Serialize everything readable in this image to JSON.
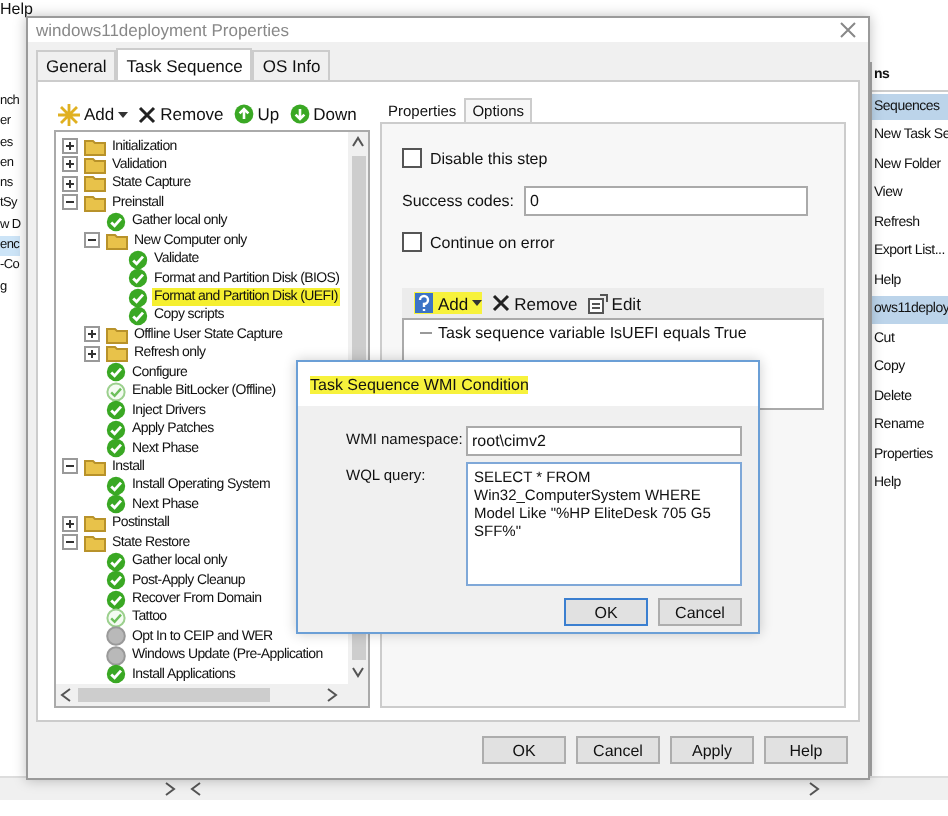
{
  "background_window": {
    "menu": "Help",
    "left_pane": [
      {
        "label": "nch",
        "selected": false
      },
      {
        "label": "er",
        "selected": false
      },
      {
        "label": "es",
        "selected": false
      },
      {
        "label": "en",
        "selected": false
      },
      {
        "label": "ns",
        "selected": false
      },
      {
        "label": "tSy",
        "selected": false
      },
      {
        "label": "w D",
        "selected": false
      },
      {
        "label": "enc",
        "selected": true
      },
      {
        "label": "-Co",
        "selected": false
      },
      {
        "label": "g",
        "selected": false
      }
    ],
    "actions": [
      {
        "kind": "header",
        "label": "ns"
      },
      {
        "kind": "section",
        "label": "Sequences"
      },
      {
        "kind": "action",
        "label": "New Task Se"
      },
      {
        "kind": "action",
        "label": "New Folder"
      },
      {
        "kind": "action",
        "label": "View"
      },
      {
        "kind": "action",
        "label": "Refresh"
      },
      {
        "kind": "action",
        "label": "Export List..."
      },
      {
        "kind": "action",
        "label": "Help"
      },
      {
        "kind": "section",
        "label": "ows11deploy"
      },
      {
        "kind": "action",
        "label": "Cut"
      },
      {
        "kind": "action",
        "label": "Copy"
      },
      {
        "kind": "action",
        "label": "Delete"
      },
      {
        "kind": "action",
        "label": "Rename"
      },
      {
        "kind": "action",
        "label": "Properties"
      },
      {
        "kind": "action",
        "label": "Help"
      }
    ]
  },
  "dialog": {
    "title": "windows11deployment Properties",
    "tabs": [
      {
        "label": "General",
        "selected": false
      },
      {
        "label": "Task Sequence",
        "selected": true
      },
      {
        "label": "OS Info",
        "selected": false
      }
    ],
    "toolbar": [
      {
        "kind": "add",
        "label": "Add"
      },
      {
        "kind": "remove",
        "label": "Remove"
      },
      {
        "kind": "up",
        "label": "Up"
      },
      {
        "kind": "down",
        "label": "Down"
      }
    ],
    "tree": [
      {
        "label": "Initialization",
        "kind": "group",
        "expanded": false,
        "selected": false
      },
      {
        "label": "Validation",
        "kind": "group",
        "expanded": false,
        "selected": false
      },
      {
        "label": "State Capture",
        "kind": "group",
        "expanded": false,
        "selected": false
      },
      {
        "label": "Preinstall",
        "kind": "group",
        "expanded": true,
        "selected": false,
        "children": [
          {
            "label": "Gather local only",
            "kind": "step",
            "selected": false
          },
          {
            "label": "New Computer only",
            "kind": "group",
            "expanded": true,
            "selected": false,
            "children": [
              {
                "label": "Validate",
                "kind": "step",
                "selected": false
              },
              {
                "label": "Format and Partition Disk (BIOS)",
                "kind": "step",
                "selected": false
              },
              {
                "label": "Format and Partition Disk (UEFI)",
                "kind": "step",
                "selected": true
              },
              {
                "label": "Copy scripts",
                "kind": "step",
                "selected": false
              }
            ]
          },
          {
            "label": "Offline User State Capture",
            "kind": "group",
            "expanded": false,
            "selected": false
          },
          {
            "label": "Refresh only",
            "kind": "group",
            "expanded": false,
            "selected": false
          },
          {
            "label": "Configure",
            "kind": "step",
            "selected": false
          },
          {
            "label": "Enable BitLocker (Offline)",
            "kind": "step-faint",
            "selected": false
          },
          {
            "label": "Inject Drivers",
            "kind": "step",
            "selected": false
          },
          {
            "label": "Apply Patches",
            "kind": "step",
            "selected": false
          },
          {
            "label": "Next Phase",
            "kind": "step",
            "selected": false
          }
        ]
      },
      {
        "label": "Install",
        "kind": "group",
        "expanded": true,
        "selected": false,
        "children": [
          {
            "label": "Install Operating System",
            "kind": "step",
            "selected": false
          },
          {
            "label": "Next Phase",
            "kind": "step",
            "selected": false
          }
        ]
      },
      {
        "label": "Postinstall",
        "kind": "group",
        "expanded": false,
        "selected": false
      },
      {
        "label": "State Restore",
        "kind": "group",
        "expanded": true,
        "selected": false,
        "children": [
          {
            "label": "Gather local only",
            "kind": "step",
            "selected": false
          },
          {
            "label": "Post-Apply Cleanup",
            "kind": "step",
            "selected": false
          },
          {
            "label": "Recover From Domain",
            "kind": "step",
            "selected": false
          },
          {
            "label": "Tattoo",
            "kind": "step-faint",
            "selected": false
          },
          {
            "label": "Opt In to CEIP and WER",
            "kind": "step-off",
            "selected": false
          },
          {
            "label": "Windows Update (Pre-Application",
            "kind": "step-off",
            "selected": false
          },
          {
            "label": "Install Applications",
            "kind": "step",
            "selected": false
          }
        ]
      }
    ],
    "step_tabs": [
      {
        "label": "Properties",
        "selected": false,
        "highlighted": false
      },
      {
        "label": "Options",
        "selected": true,
        "highlighted": true
      }
    ],
    "options": {
      "disable_step": {
        "label": "Disable this step",
        "checked": false
      },
      "success_codes": {
        "label": "Success codes:",
        "value": "0"
      },
      "continue_on_error": {
        "label": "Continue on error",
        "checked": false
      },
      "condition_toolbar": [
        {
          "kind": "add",
          "label": "Add",
          "highlighted": true
        },
        {
          "kind": "remove",
          "label": "Remove",
          "highlighted": false
        },
        {
          "kind": "edit",
          "label": "Edit",
          "highlighted": false
        }
      ],
      "conditions": [
        "Task sequence variable IsUEFI equals True"
      ]
    },
    "buttons": [
      "OK",
      "Cancel",
      "Apply",
      "Help"
    ]
  },
  "wmi_dialog": {
    "title": "Task Sequence WMI Condition",
    "title_highlighted": true,
    "namespace": {
      "label": "WMI namespace:",
      "value": "root\\cimv2"
    },
    "query": {
      "label": "WQL query:",
      "value": "SELECT * FROM Win32_ComputerSystem WHERE Model Like \"%HP EliteDesk 705 G5 SFF%\""
    },
    "buttons": [
      {
        "label": "OK",
        "default": true
      },
      {
        "label": "Cancel",
        "default": false
      }
    ]
  }
}
